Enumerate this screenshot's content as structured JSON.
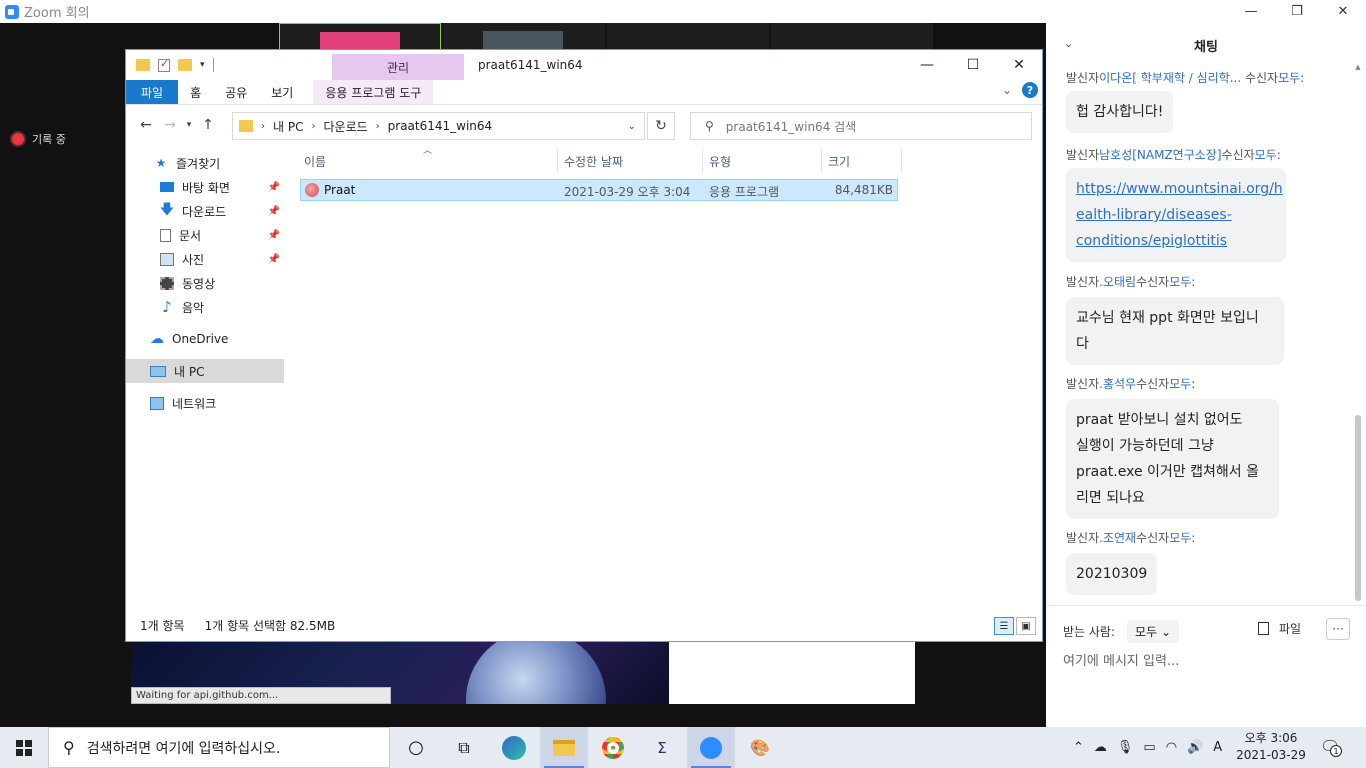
{
  "zoom": {
    "window_title": "Zoom 회의",
    "recording_label": "기록 중",
    "status_tip": "Waiting for api.github.com..."
  },
  "window_controls": {
    "minimize": "—",
    "restore": "❐",
    "close": "✕"
  },
  "explorer": {
    "title": "praat6141_win64",
    "manage_tab": "관리",
    "ribbon_tabs": [
      "파일",
      "홈",
      "공유",
      "보기",
      "응용 프로그램 도구"
    ],
    "address": {
      "crumbs": [
        "내 PC",
        "다운로드",
        "praat6141_win64"
      ]
    },
    "search_placeholder": "praat6141_win64 검색",
    "nav": {
      "quick_access": "즐겨찾기",
      "items": [
        {
          "label": "바탕 화면",
          "pinned": true
        },
        {
          "label": "다운로드",
          "pinned": true
        },
        {
          "label": "문서",
          "pinned": true
        },
        {
          "label": "사진",
          "pinned": true
        },
        {
          "label": "동영상",
          "pinned": false
        },
        {
          "label": "음악",
          "pinned": false
        }
      ],
      "onedrive": "OneDrive",
      "this_pc": "내 PC",
      "network": "네트워크"
    },
    "columns": [
      "이름",
      "수정한 날짜",
      "유형",
      "크기"
    ],
    "files": [
      {
        "name": "Praat",
        "modified": "2021-03-29 오후 3:04",
        "type": "응용 프로그램",
        "size": "84,481KB"
      }
    ],
    "status": {
      "count": "1개 항목",
      "selected": "1개 항목 선택함 82.5MB"
    }
  },
  "chat": {
    "title": "채팅",
    "messages": [
      {
        "prefix": "발신자",
        "name": "이다온[ 학부재학 / 심리학...",
        "suffix": " 수신자",
        "to": "모두",
        "colon": ":",
        "text": "헙 감사합니다!"
      },
      {
        "prefix": "발신자",
        "name": "남호성[NAMZ연구소장]",
        "suffix": "수신자",
        "to": "모두",
        "colon": ":",
        "link_lines": [
          "https://www.mountsinai.org/h",
          "ealth-library/diseases-",
          "conditions/epiglottitis"
        ]
      },
      {
        "prefix": "발신자",
        "name": ".오태림",
        "suffix": "수신자",
        "to": "모두",
        "colon": ":",
        "lines": [
          "교수님 현재 ppt 화면만 보입니",
          "다"
        ]
      },
      {
        "prefix": "발신자",
        "name": ".홍석우",
        "suffix": "수신자",
        "to": "모두",
        "colon": ":",
        "lines": [
          "praat 받아보니 설치 없어도",
          "실행이 가능하던데 그냥",
          "praat.exe 이거만 캡쳐해서 올",
          "리면 되나요"
        ]
      },
      {
        "prefix": "발신자",
        "name": ".조연재",
        "suffix": "수신자",
        "to": "모두",
        "colon": ":",
        "text": "20210309"
      }
    ],
    "to_label": "받는 사람:",
    "to_value": "모두",
    "file_label": "파일",
    "more_label": "···",
    "input_placeholder": "여기에 메시지 입력..."
  },
  "taskbar": {
    "search_placeholder": "검색하려면 여기에 입력하십시오.",
    "time": "오후 3:06",
    "date": "2021-03-29",
    "notifications": "1",
    "ime": "A"
  }
}
